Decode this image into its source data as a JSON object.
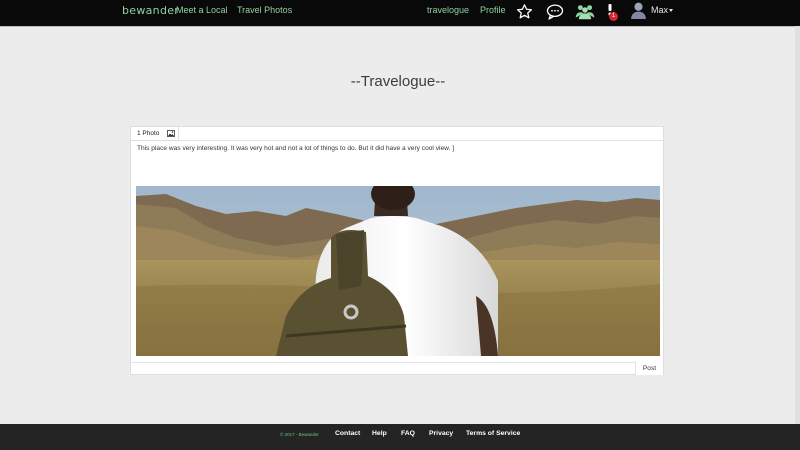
{
  "nav": {
    "brand": "bewander",
    "links": [
      "Meet a Local",
      "Travel Photos"
    ],
    "right_links": [
      "travelogue",
      "Profile"
    ],
    "notification_count": "1",
    "user": "Max",
    "icons": [
      "star-icon",
      "chat-bubble-icon",
      "group-icon",
      "alert-icon",
      "user-avatar-icon"
    ],
    "accent_color": "#8fd39f"
  },
  "page": {
    "title": "--Travelogue--"
  },
  "post": {
    "tab_label": "1 Photo",
    "tab_icon": "image-icon",
    "text": "This place was very interesting. It was very hot and not a lot of things to do. But it did have a very cool view. ]",
    "post_button": "Post"
  },
  "footer": {
    "copyright": "© 2017 - Bewander",
    "links": [
      "Contact",
      "Help",
      "FAQ",
      "Privacy",
      "Terms of Service"
    ]
  }
}
